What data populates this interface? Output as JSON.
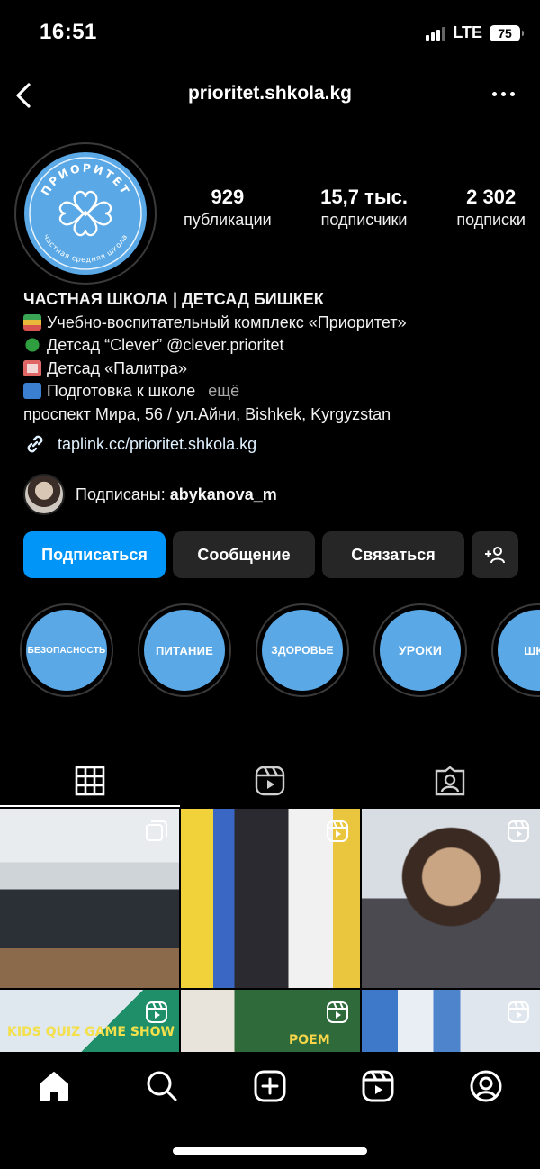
{
  "status_bar": {
    "time": "16:51",
    "network": "LTE",
    "battery": "75"
  },
  "header": {
    "username": "prioritet.shkola.kg",
    "back_icon": "chevron-left-icon",
    "more_icon": "more-horizontal-icon"
  },
  "profile": {
    "avatar_logo_text": "ПРИОРИТЕТ",
    "avatar_logo_subtext": "частная средняя школа",
    "stats": [
      {
        "value": "929",
        "label": "публикации"
      },
      {
        "value": "15,7 тыс.",
        "label": "подписчики"
      },
      {
        "value": "2 302",
        "label": "подписки"
      }
    ]
  },
  "bio": {
    "name": "ЧАСТНАЯ ШКОЛА | ДЕТСАД БИШКЕК",
    "lines": [
      {
        "emoji": "books-emoji",
        "text": "Учебно-воспитательный комплекс «Приоритет»"
      },
      {
        "emoji": "four-leaf-clover-emoji",
        "text": "Детсад “Clever” @clever.prioritet"
      },
      {
        "emoji": "hospital-emoji",
        "text": "Детсад «Палитра»"
      },
      {
        "emoji": "blue-book-emoji",
        "text": "Подготовка к школе",
        "more": "ещё"
      }
    ],
    "address": "проспект Мира, 56 / ул.Айни, Bishkek, Kyrgyzstan",
    "link": "taplink.cc/prioritet.shkola.kg"
  },
  "followed_by": {
    "prefix": "Подписаны: ",
    "user": "abykanova_m"
  },
  "actions": {
    "follow": "Подписаться",
    "message": "Сообщение",
    "contact": "Связаться"
  },
  "highlights": [
    {
      "label": "БЕЗОПАСНОСТЬ"
    },
    {
      "label": "ПИТАНИЕ"
    },
    {
      "label": "ЗДОРОВЬЕ"
    },
    {
      "label": "УРОКИ"
    },
    {
      "label": "ШКО"
    }
  ],
  "tabs": [
    "grid-icon",
    "reels-icon",
    "tagged-icon"
  ],
  "posts": [
    {
      "kind": "carousel",
      "scene": "group-photo-classroom"
    },
    {
      "kind": "reel",
      "scene": "students-with-teacher"
    },
    {
      "kind": "reel",
      "scene": "woman-portrait"
    },
    {
      "kind": "reel",
      "scene": "kids-quiz",
      "caption": "KIDS QUIZ GAME SHOW"
    },
    {
      "kind": "reel",
      "scene": "classroom-board",
      "caption": "POEM"
    },
    {
      "kind": "reel",
      "scene": "woman-office"
    }
  ],
  "bottom_nav": [
    "home-icon",
    "search-icon",
    "create-icon",
    "reels-icon",
    "profile-icon"
  ],
  "colors": {
    "background": "#000000",
    "accent": "#0095f6",
    "button": "#262626",
    "brand_blue": "#5aa9e6"
  }
}
